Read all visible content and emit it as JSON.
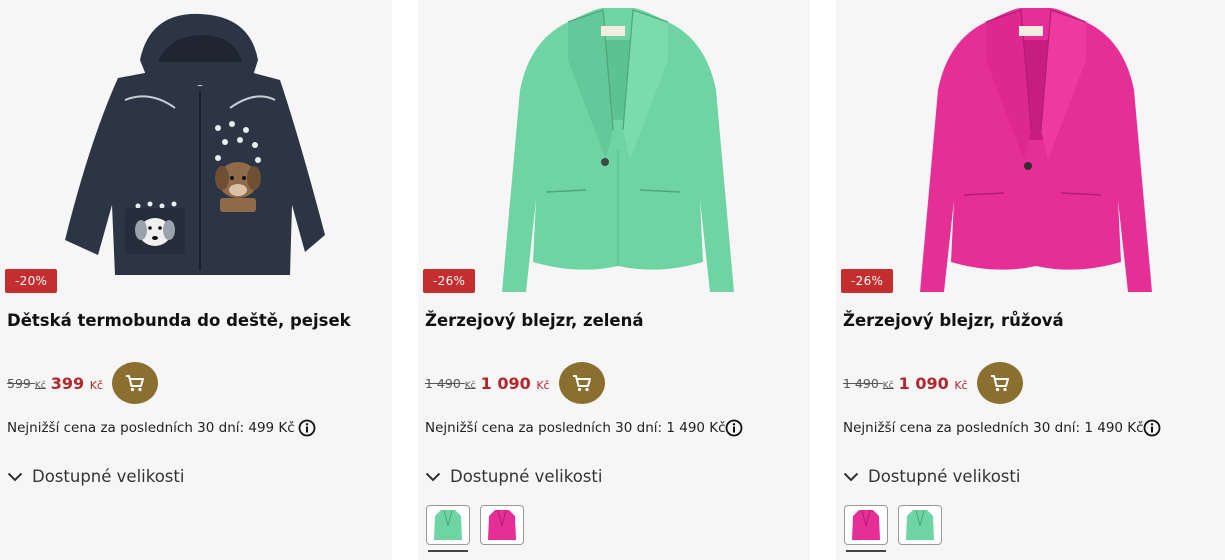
{
  "products": [
    {
      "badge": "-20%",
      "title": "Dětská termobunda do deště, pejsek",
      "old_price": "599",
      "old_currency": "Kč",
      "price": "399",
      "currency": "Kč",
      "lowest_price_text": "Nejnižší cena za posledních 30 dní: 499 Kč",
      "sizes_label": "Dostupné velikosti",
      "image_icon": "kids-rain-jacket-image",
      "colors": {
        "main": "#2c3544"
      },
      "swatches": []
    },
    {
      "badge": "-26%",
      "title": "Žerzejový blejzr, zelená",
      "old_price": "1 490",
      "old_currency": "Kč",
      "price": "1 090",
      "currency": "Kč",
      "lowest_price_text": "Nejnižší cena za posledních 30 dní: 1 490 Kč",
      "sizes_label": "Dostupné velikosti",
      "image_icon": "green-blazer-image",
      "colors": {
        "main": "#6fd4a4"
      },
      "swatches": [
        {
          "color": "#6fd4a4",
          "selected": true
        },
        {
          "color": "#e62e97",
          "selected": false
        }
      ]
    },
    {
      "badge": "-26%",
      "title": "Žerzejový blejzr, růžová",
      "old_price": "1 490",
      "old_currency": "Kč",
      "price": "1 090",
      "currency": "Kč",
      "lowest_price_text": "Nejnižší cena za posledních 30 dní: 1 490 Kč",
      "sizes_label": "Dostupné velikosti",
      "image_icon": "pink-blazer-image",
      "colors": {
        "main": "#e62e97"
      },
      "swatches": [
        {
          "color": "#e62e97",
          "selected": true
        },
        {
          "color": "#6fd4a4",
          "selected": false
        }
      ]
    }
  ],
  "theme": {
    "badge_bg": "#c42e2e",
    "price_color": "#b3272b",
    "cart_button_bg": "#8a6f30",
    "card_bg": "#f6f6f6"
  },
  "icons": {
    "cart": "cart-icon",
    "info": "info-icon",
    "chevron": "chevron-down-icon"
  }
}
